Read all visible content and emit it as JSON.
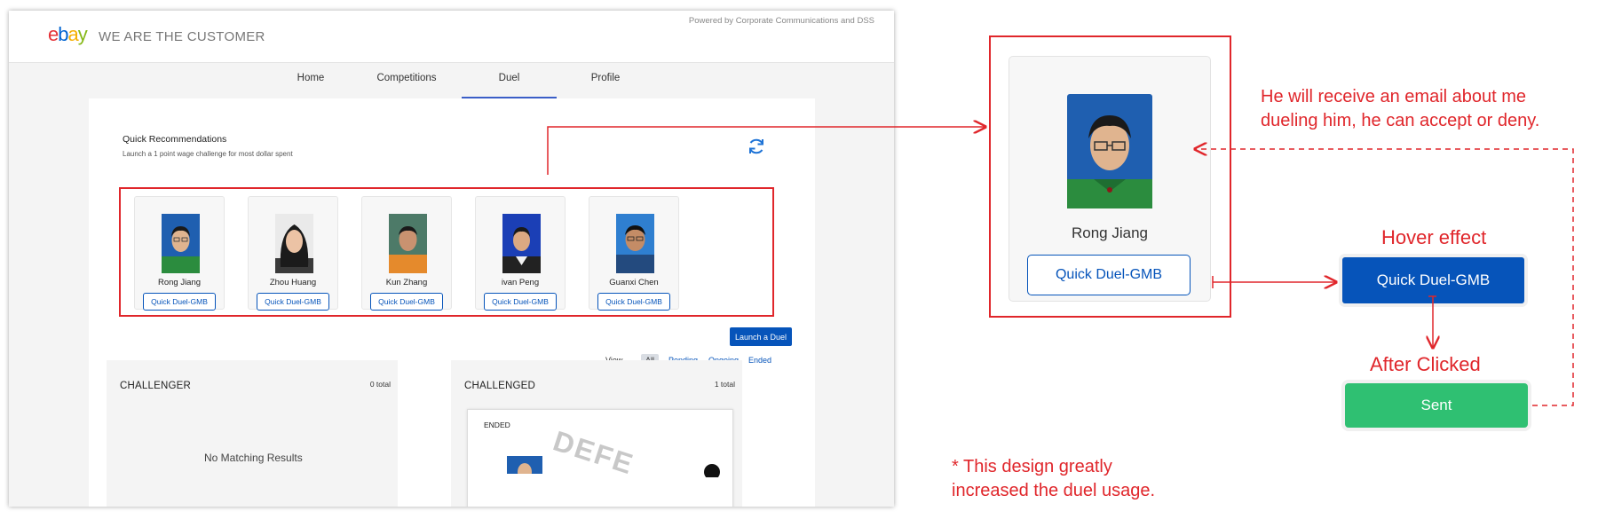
{
  "header": {
    "logo": {
      "e": "e",
      "b": "b",
      "a": "a",
      "y": "y"
    },
    "tagline": "WE ARE THE CUSTOMER",
    "powered_by": "Powered by Corporate Communications and DSS"
  },
  "nav": {
    "items": [
      {
        "label": "Home"
      },
      {
        "label": "Competitions"
      },
      {
        "label": "Duel"
      },
      {
        "label": "Profile"
      }
    ],
    "active": "Duel"
  },
  "quick": {
    "title": "Quick Recommendations",
    "subtitle": "Launch a 1 point wage challenge for most dollar spent",
    "refresh_icon": "refresh-icon",
    "cards": [
      {
        "name": "Rong Jiang",
        "button": "Quick Duel-GMB"
      },
      {
        "name": "Zhou Huang",
        "button": "Quick Duel-GMB"
      },
      {
        "name": "Kun Zhang",
        "button": "Quick Duel-GMB"
      },
      {
        "name": "ivan Peng",
        "button": "Quick Duel-GMB"
      },
      {
        "name": "Guanxi Chen",
        "button": "Quick Duel-GMB"
      }
    ]
  },
  "launch_button": "Launch a Duel",
  "view_by": {
    "label": "View by:",
    "options": [
      "All",
      "Pending",
      "Ongoing",
      "Ended"
    ],
    "selected": "All"
  },
  "panels": {
    "challenger": {
      "title": "CHALLENGER",
      "total": "0 total",
      "empty": "No Matching Results"
    },
    "challenged": {
      "title": "CHALLENGED",
      "total": "1 total",
      "card_status": "ENDED",
      "stamp": "DEFE"
    }
  },
  "annotation": {
    "zoom_name": "Rong Jiang",
    "zoom_button": "Quick Duel-GMB",
    "email_note_line1": "He will receive an email about me",
    "email_note_line2": "dueling him, he can accept or deny.",
    "hover_label": "Hover effect",
    "hover_button": "Quick Duel-GMB",
    "after_label": "After Clicked",
    "sent_button": "Sent",
    "footnote_line1": "* This design greatly",
    "footnote_line2": "increased the duel usage."
  },
  "colors": {
    "brand_blue": "#0654ba",
    "annotation_red": "#e0262b",
    "sent_green": "#2fc072",
    "ebay_red": "#e53238",
    "ebay_blue": "#0064d2",
    "ebay_yellow": "#f5af02",
    "ebay_green": "#86b817"
  }
}
